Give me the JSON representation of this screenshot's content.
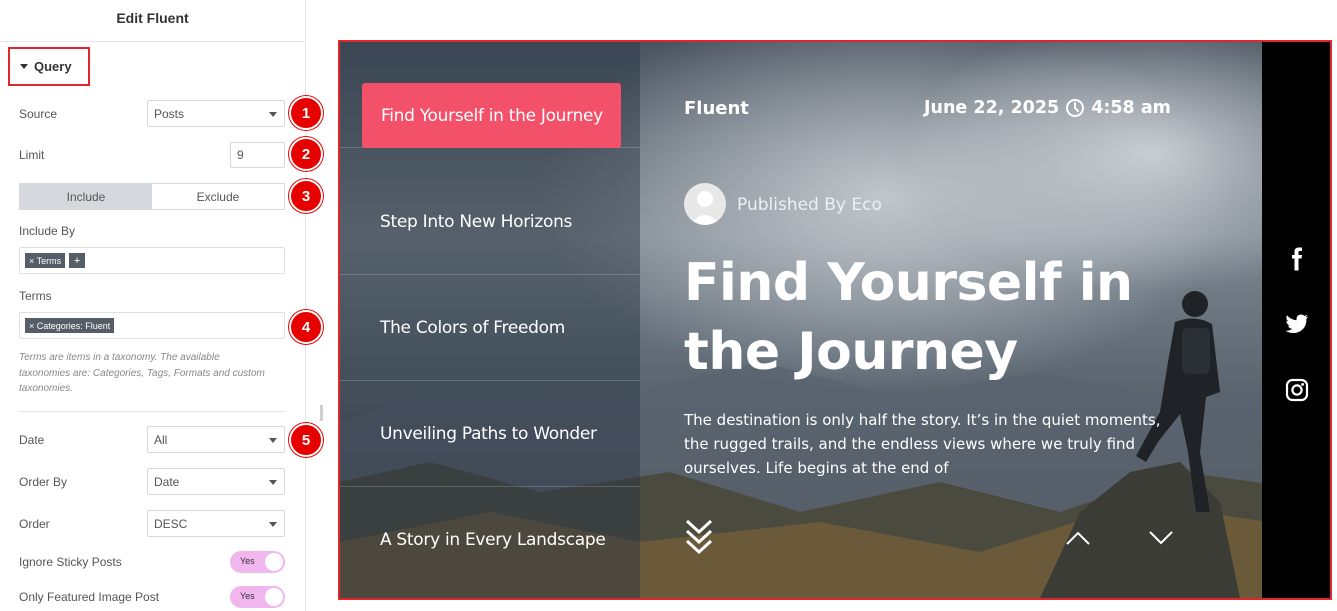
{
  "panel": {
    "title": "Edit Fluent",
    "section": "Query",
    "source": {
      "label": "Source",
      "value": "Posts"
    },
    "limit": {
      "label": "Limit",
      "value": "9"
    },
    "include_toggle": {
      "include": "Include",
      "exclude": "Exclude",
      "active": "Include"
    },
    "include_by": {
      "label": "Include By",
      "tags": [
        "× Terms"
      ],
      "add": "+"
    },
    "terms": {
      "label": "Terms",
      "tags": [
        "× Categories: Fluent"
      ]
    },
    "help": "Terms are items in a taxonomy. The available taxonomies are: Categories, Tags, Formats and custom taxonomies.",
    "date": {
      "label": "Date",
      "value": "All"
    },
    "order_by": {
      "label": "Order By",
      "value": "Date"
    },
    "order": {
      "label": "Order",
      "value": "DESC"
    },
    "ignore_sticky": {
      "label": "Ignore Sticky Posts",
      "value": "Yes"
    },
    "featured_only": {
      "label": "Only Featured Image Post",
      "value": "Yes"
    },
    "badges": [
      "1",
      "2",
      "3",
      "4",
      "5"
    ]
  },
  "preview": {
    "nav_items": [
      "Find Yourself in the Journey",
      "Step Into New Horizons",
      "The Colors of Freedom",
      "Unveiling Paths to Wonder",
      "A Story in Every Landscape"
    ],
    "active_index": 0,
    "brand": "Fluent",
    "date": "June 22, 2025",
    "time": "4:58 am",
    "author": "Published By Eco",
    "headline_line1": "Find Yourself in",
    "headline_line2": "the Journey",
    "excerpt": "The destination is only half the story. It’s in the quiet moments, the rugged trails, and the endless views where we truly find ourselves. Life begins at the end of",
    "social": [
      "facebook-icon",
      "twitter-icon",
      "instagram-icon"
    ],
    "colors": {
      "accent": "#f3506a",
      "highlight_border": "#e0252b",
      "badge": "#e60000",
      "switch": "#f2b6ef"
    }
  }
}
